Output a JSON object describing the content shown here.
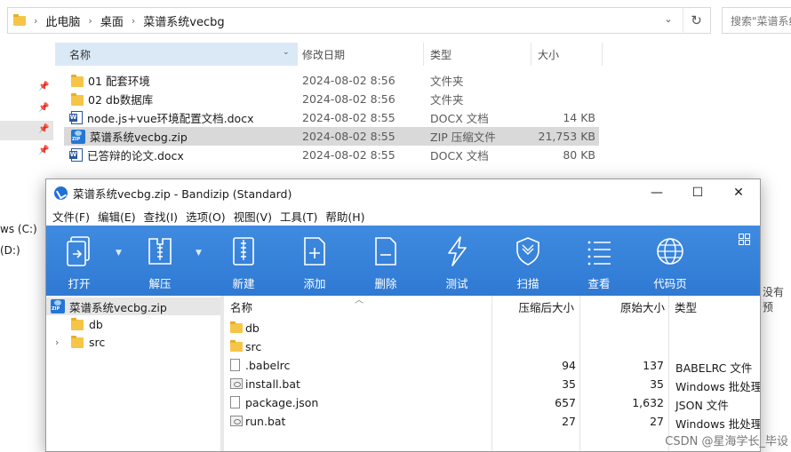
{
  "explorer": {
    "breadcrumbs": [
      "此电脑",
      "桌面",
      "菜谱系统vecbg"
    ],
    "search_placeholder": "搜索\"菜谱系统vecbg\"",
    "nav_drives": [
      "ws (C:)",
      "(D:)"
    ],
    "columns": {
      "name": "名称",
      "modified": "修改日期",
      "type": "类型",
      "size": "大小"
    },
    "files": [
      {
        "name": "01  配套环境",
        "modified": "2024-08-02 8:56",
        "type": "文件夹",
        "size": "",
        "icon": "folder-icon"
      },
      {
        "name": "02 db数据库",
        "modified": "2024-08-02 8:56",
        "type": "文件夹",
        "size": "",
        "icon": "folder-icon"
      },
      {
        "name": "node.js+vue环境配置文档.docx",
        "modified": "2024-08-02 8:55",
        "type": "DOCX 文档",
        "size": "14 KB",
        "icon": "word-doc-icon"
      },
      {
        "name": "菜谱系统vecbg.zip",
        "modified": "2024-08-02 8:55",
        "type": "ZIP 压缩文件",
        "size": "21,753 KB",
        "icon": "zip-archive-icon"
      },
      {
        "name": "已答辩的论文.docx",
        "modified": "2024-08-02 8:55",
        "type": "DOCX 文档",
        "size": "80 KB",
        "icon": "word-doc-icon"
      }
    ],
    "selected_index": 3,
    "right_clipped_text": "没有预"
  },
  "bandizip": {
    "title": "菜谱系统vecbg.zip - Bandizip (Standard)",
    "menu": [
      "文件(F)",
      "编辑(E)",
      "查找(I)",
      "选项(O)",
      "视图(V)",
      "工具(T)",
      "帮助(H)"
    ],
    "toolbar": [
      {
        "label": "打开",
        "icon": "open-icon"
      },
      {
        "label": "解压",
        "icon": "extract-icon"
      },
      {
        "label": "新建",
        "icon": "new-archive-icon"
      },
      {
        "label": "添加",
        "icon": "add-file-icon"
      },
      {
        "label": "删除",
        "icon": "delete-file-icon"
      },
      {
        "label": "测试",
        "icon": "test-lightning-icon"
      },
      {
        "label": "扫描",
        "icon": "scan-shield-icon"
      },
      {
        "label": "查看",
        "icon": "view-list-icon"
      },
      {
        "label": "代码页",
        "icon": "codepage-globe-icon"
      }
    ],
    "tree": [
      {
        "label": "菜谱系统vecbg.zip",
        "icon": "zip-archive-icon",
        "expandable": false
      },
      {
        "label": "db",
        "icon": "folder-icon",
        "expandable": false
      },
      {
        "label": "src",
        "icon": "folder-icon",
        "expandable": true
      }
    ],
    "list_columns": {
      "name": "名称",
      "compressed": "压缩后大小",
      "original": "原始大小",
      "type": "类型"
    },
    "entries": [
      {
        "name": "db",
        "compressed": "",
        "original": "",
        "type": "",
        "icon": "folder-icon"
      },
      {
        "name": "src",
        "compressed": "",
        "original": "",
        "type": "",
        "icon": "folder-icon"
      },
      {
        "name": ".babelrc",
        "compressed": "94",
        "original": "137",
        "type": "BABELRC 文件",
        "icon": "file-icon"
      },
      {
        "name": "install.bat",
        "compressed": "35",
        "original": "35",
        "type": "Windows 批处理文件",
        "icon": "batch-file-icon"
      },
      {
        "name": "package.json",
        "compressed": "657",
        "original": "1,632",
        "type": "JSON 文件",
        "icon": "file-icon"
      },
      {
        "name": "run.bat",
        "compressed": "27",
        "original": "27",
        "type": "Windows 批处理文件",
        "icon": "batch-file-icon"
      }
    ]
  },
  "watermark": "CSDN @星海学长_毕设"
}
